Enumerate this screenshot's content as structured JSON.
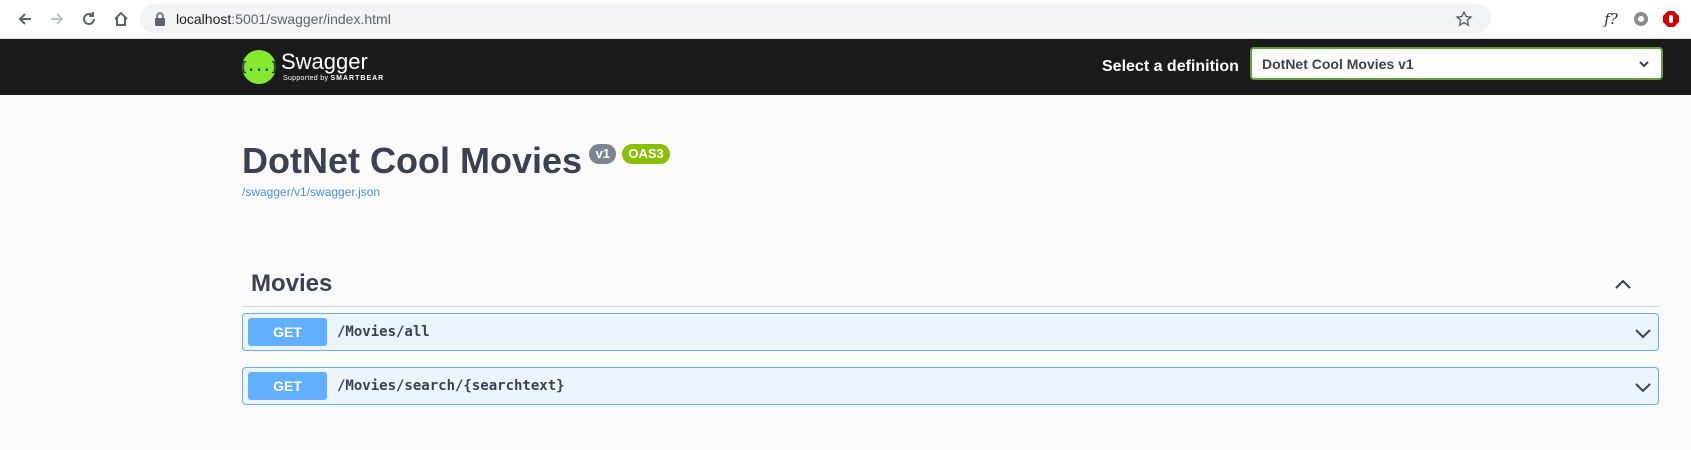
{
  "browser": {
    "url_host": "localhost",
    "url_rest": ":5001/swagger/index.html",
    "icons": [
      "back-icon",
      "forward-icon",
      "reload-icon",
      "home-icon",
      "lock-icon",
      "star-icon"
    ],
    "ext_f_label": "f?"
  },
  "topbar": {
    "logo_glyph": "{...}",
    "logo_title": "Swagger",
    "logo_sub_prefix": "Supported by",
    "logo_sub_brand": "SMARTBEAR",
    "select_label": "Select a definition",
    "selected_definition": "DotNet Cool Movies v1"
  },
  "info": {
    "title": "DotNet Cool Movies",
    "version_badge": "v1",
    "oas_badge": "OAS3",
    "spec_url": "/swagger/v1/swagger.json"
  },
  "tag": {
    "name": "Movies",
    "operations": [
      {
        "method": "GET",
        "path": "/Movies/all"
      },
      {
        "method": "GET",
        "path": "/Movies/search/{searchtext}"
      }
    ]
  },
  "colors": {
    "topbar_bg": "#1b1b1b",
    "logo_green": "#85ea2d",
    "get_blue": "#61affe",
    "get_bg": "#ebf3fb",
    "badge_gray": "#7d8492",
    "badge_green": "#89bf04",
    "link_blue": "#4990e2"
  }
}
